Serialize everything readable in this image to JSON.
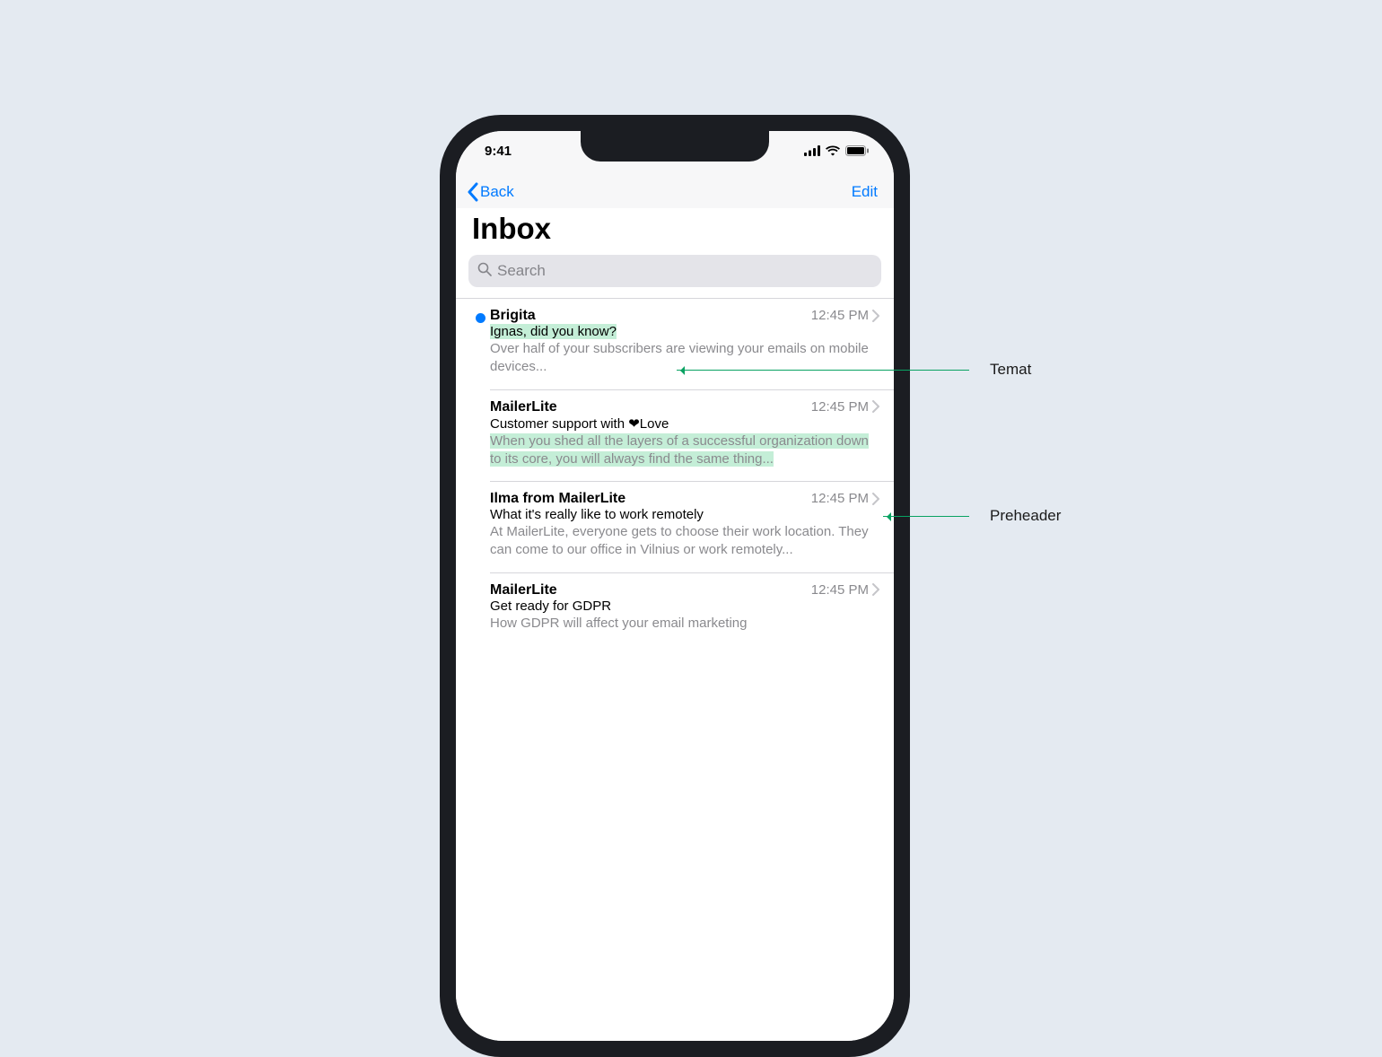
{
  "status": {
    "time": "9:41"
  },
  "nav": {
    "back_label": "Back",
    "edit_label": "Edit",
    "title": "Inbox"
  },
  "search": {
    "placeholder": "Search"
  },
  "emails": [
    {
      "sender": "Brigita",
      "time": "12:45 PM",
      "subject": "Ignas, did you know?",
      "preview": "Over half of your subscribers are viewing your emails on mobile devices...",
      "unread": true,
      "highlight": "subject"
    },
    {
      "sender": "MailerLite",
      "time": "12:45 PM",
      "subject": "Customer support with ❤Love",
      "preview": "When you shed all the layers of a successful organization down to its core, you will always find the same thing...",
      "unread": false,
      "highlight": "preview"
    },
    {
      "sender": "Ilma from MailerLite",
      "time": "12:45 PM",
      "subject": "What it's really like to work remotely",
      "preview": "At MailerLite, everyone gets to choose their work location. They can come to our office in Vilnius or work remotely...",
      "unread": false,
      "highlight": "none"
    },
    {
      "sender": "MailerLite",
      "time": "12:45 PM",
      "subject": "Get ready for GDPR",
      "preview": "How GDPR will affect your email marketing",
      "unread": false,
      "highlight": "none"
    }
  ],
  "callouts": {
    "subject_label": "Temat",
    "preheader_label": "Preheader"
  }
}
